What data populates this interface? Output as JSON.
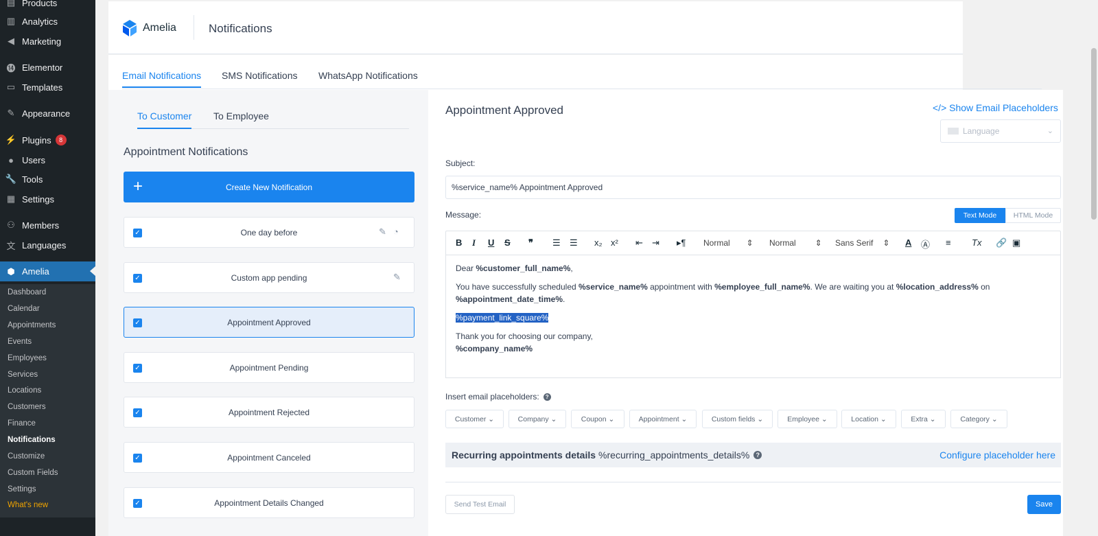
{
  "wp_menu": [
    {
      "label": "Products",
      "icon": "products-icon"
    },
    {
      "label": "Analytics",
      "icon": "analytics-icon"
    },
    {
      "label": "Marketing",
      "icon": "megaphone-icon"
    },
    {
      "label": "Elementor",
      "icon": "elementor-icon"
    },
    {
      "label": "Templates",
      "icon": "folder-icon"
    },
    {
      "label": "Appearance",
      "icon": "brush-icon"
    },
    {
      "label": "Plugins",
      "icon": "plug-icon",
      "badge": "8"
    },
    {
      "label": "Users",
      "icon": "user-icon"
    },
    {
      "label": "Tools",
      "icon": "wrench-icon"
    },
    {
      "label": "Settings",
      "icon": "settings-icon"
    },
    {
      "label": "Members",
      "icon": "members-icon"
    },
    {
      "label": "Languages",
      "icon": "languages-icon"
    },
    {
      "label": "Amelia",
      "icon": "amelia-icon"
    }
  ],
  "amelia_submenu": [
    "Dashboard",
    "Calendar",
    "Appointments",
    "Events",
    "Employees",
    "Services",
    "Locations",
    "Customers",
    "Finance",
    "Notifications",
    "Customize",
    "Custom Fields",
    "Settings",
    "What's new"
  ],
  "header": {
    "logo_text": "Amelia",
    "title": "Notifications"
  },
  "top_tabs": [
    "Email Notifications",
    "SMS Notifications",
    "WhatsApp Notifications"
  ],
  "sub_tabs": [
    "To Customer",
    "To Employee"
  ],
  "left": {
    "section_title": "Appointment Notifications",
    "create_label": "Create New Notification",
    "items": [
      "One day before",
      "Custom app pending",
      "Appointment Approved",
      "Appointment Pending",
      "Appointment Rejected",
      "Appointment Canceled",
      "Appointment Details Changed"
    ]
  },
  "right": {
    "title": "Appointment Approved",
    "placeholders_link": "</> Show Email Placeholders",
    "language_placeholder": "Language",
    "subject_label": "Subject:",
    "subject_value": "%service_name% Appointment Approved",
    "message_label": "Message:",
    "text_mode": "Text Mode",
    "html_mode": "HTML Mode",
    "toolbar": {
      "size1": "Normal",
      "size2": "Normal",
      "font": "Sans Serif"
    },
    "message": {
      "dear": "Dear ",
      "customer_ph": "%customer_full_name%",
      "comma": ",",
      "l2a": "You have successfully scheduled ",
      "service_ph": "%service_name%",
      "l2b": " appointment with ",
      "employee_ph": "%employee_full_name%",
      "l2c": ". We are waiting you at ",
      "location_ph": "%location_address%",
      "l2d": " on ",
      "datetime_ph": "%appointment_date_time%",
      "period": ".",
      "payment_ph": "%payment_link_square%",
      "thanks": "Thank you for choosing our company,",
      "company_ph": "%company_name%"
    },
    "insert_label": "Insert email placeholders:",
    "chips": [
      "Customer",
      "Company",
      "Coupon",
      "Appointment",
      "Custom fields",
      "Employee",
      "Location",
      "Extra",
      "Category"
    ],
    "recurring_bold": "Recurring appointments details",
    "recurring_ph": "%recurring_appointments_details%",
    "configure_link": "Configure placeholder here",
    "send_test": "Send Test Email",
    "save": "Save"
  },
  "colors": {
    "accent": "#1a84ee",
    "wp_sidebar": "#1d2327",
    "wp_active": "#2271b1",
    "badge": "#d63638"
  }
}
